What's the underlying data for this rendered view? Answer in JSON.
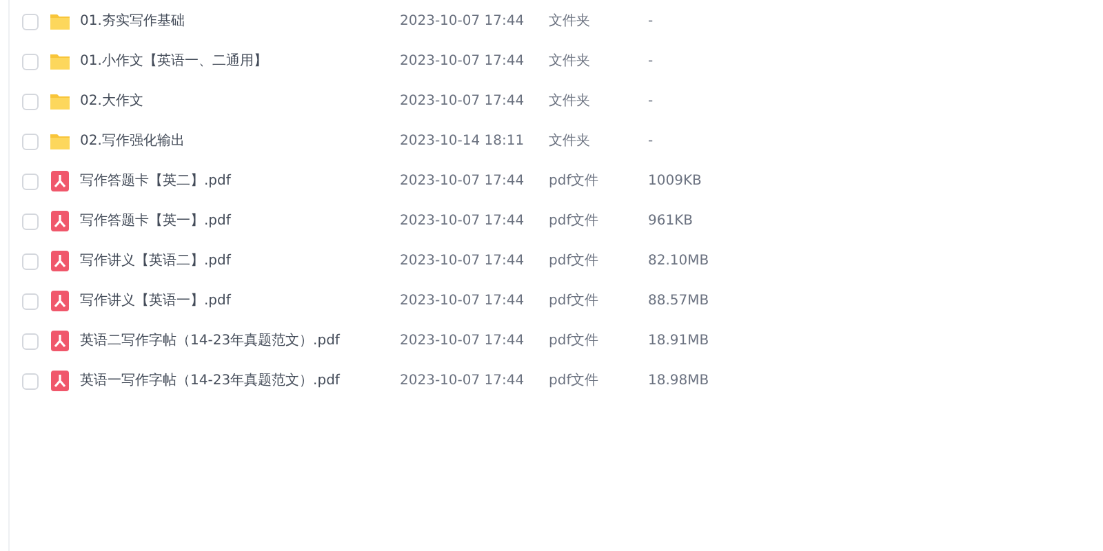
{
  "files": [
    {
      "kind": "folder",
      "checked": false,
      "name": "01.夯实写作基础",
      "modified": "2023-10-07 17:44",
      "type": "文件夹",
      "size": "-"
    },
    {
      "kind": "folder",
      "checked": false,
      "name": "01.小作文【英语一、二通用】",
      "modified": "2023-10-07 17:44",
      "type": "文件夹",
      "size": "-"
    },
    {
      "kind": "folder",
      "checked": false,
      "name": "02.大作文",
      "modified": "2023-10-07 17:44",
      "type": "文件夹",
      "size": "-"
    },
    {
      "kind": "folder",
      "checked": false,
      "name": "02.写作强化输出",
      "modified": "2023-10-14 18:11",
      "type": "文件夹",
      "size": "-"
    },
    {
      "kind": "pdf",
      "checked": false,
      "name": "写作答题卡【英二】.pdf",
      "modified": "2023-10-07 17:44",
      "type": "pdf文件",
      "size": "1009KB"
    },
    {
      "kind": "pdf",
      "checked": false,
      "name": "写作答题卡【英一】.pdf",
      "modified": "2023-10-07 17:44",
      "type": "pdf文件",
      "size": "961KB"
    },
    {
      "kind": "pdf",
      "checked": false,
      "name": "写作讲义【英语二】.pdf",
      "modified": "2023-10-07 17:44",
      "type": "pdf文件",
      "size": "82.10MB"
    },
    {
      "kind": "pdf",
      "checked": false,
      "name": "写作讲义【英语一】.pdf",
      "modified": "2023-10-07 17:44",
      "type": "pdf文件",
      "size": "88.57MB"
    },
    {
      "kind": "pdf",
      "checked": false,
      "name": "英语二写作字帖（14-23年真题范文）.pdf",
      "modified": "2023-10-07 17:44",
      "type": "pdf文件",
      "size": "18.91MB"
    },
    {
      "kind": "pdf",
      "checked": false,
      "name": "英语一写作字帖（14-23年真题范文）.pdf",
      "modified": "2023-10-07 17:44",
      "type": "pdf文件",
      "size": "18.98MB"
    }
  ]
}
